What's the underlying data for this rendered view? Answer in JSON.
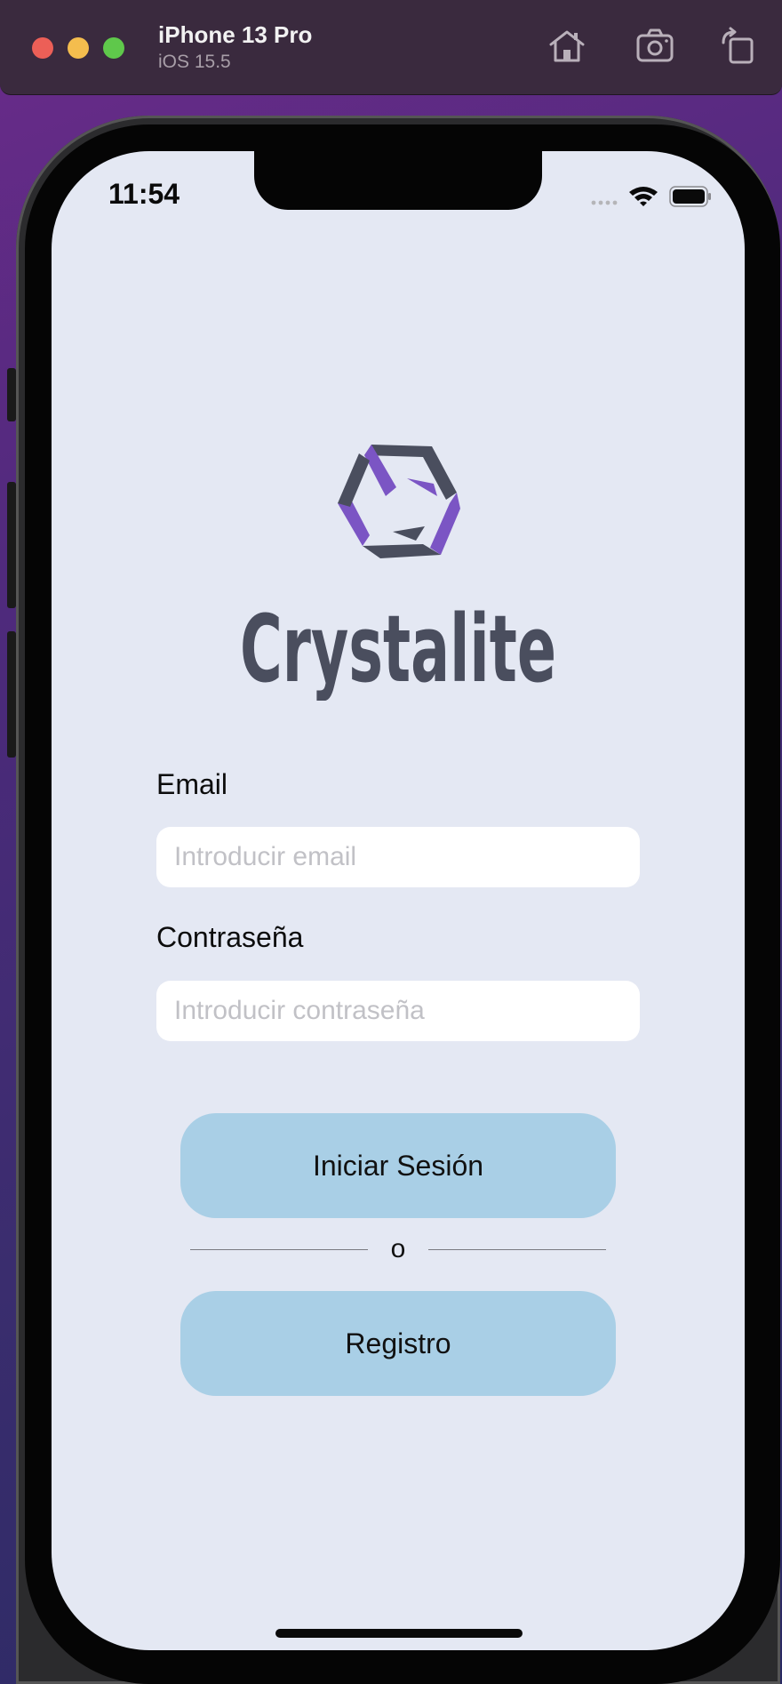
{
  "simulator": {
    "device_name": "iPhone 13 Pro",
    "os_version": "iOS 15.5",
    "toolbar_icons": [
      "home-icon",
      "screenshot-icon",
      "rotate-icon"
    ]
  },
  "status_bar": {
    "time": "11:54",
    "icons": [
      "signal-icon",
      "wifi-icon",
      "battery-icon"
    ]
  },
  "brand": {
    "name": "Crystalite",
    "colors": {
      "purple": "#7b55c4",
      "slate": "#4a4e5e"
    }
  },
  "form": {
    "email_label": "Email",
    "email_placeholder": "Introducir email",
    "password_label": "Contraseña",
    "password_placeholder": "Introducir contraseña"
  },
  "actions": {
    "login_label": "Iniciar Sesión",
    "divider_text": "o",
    "register_label": "Registro",
    "button_color": "#a9cfe6"
  }
}
